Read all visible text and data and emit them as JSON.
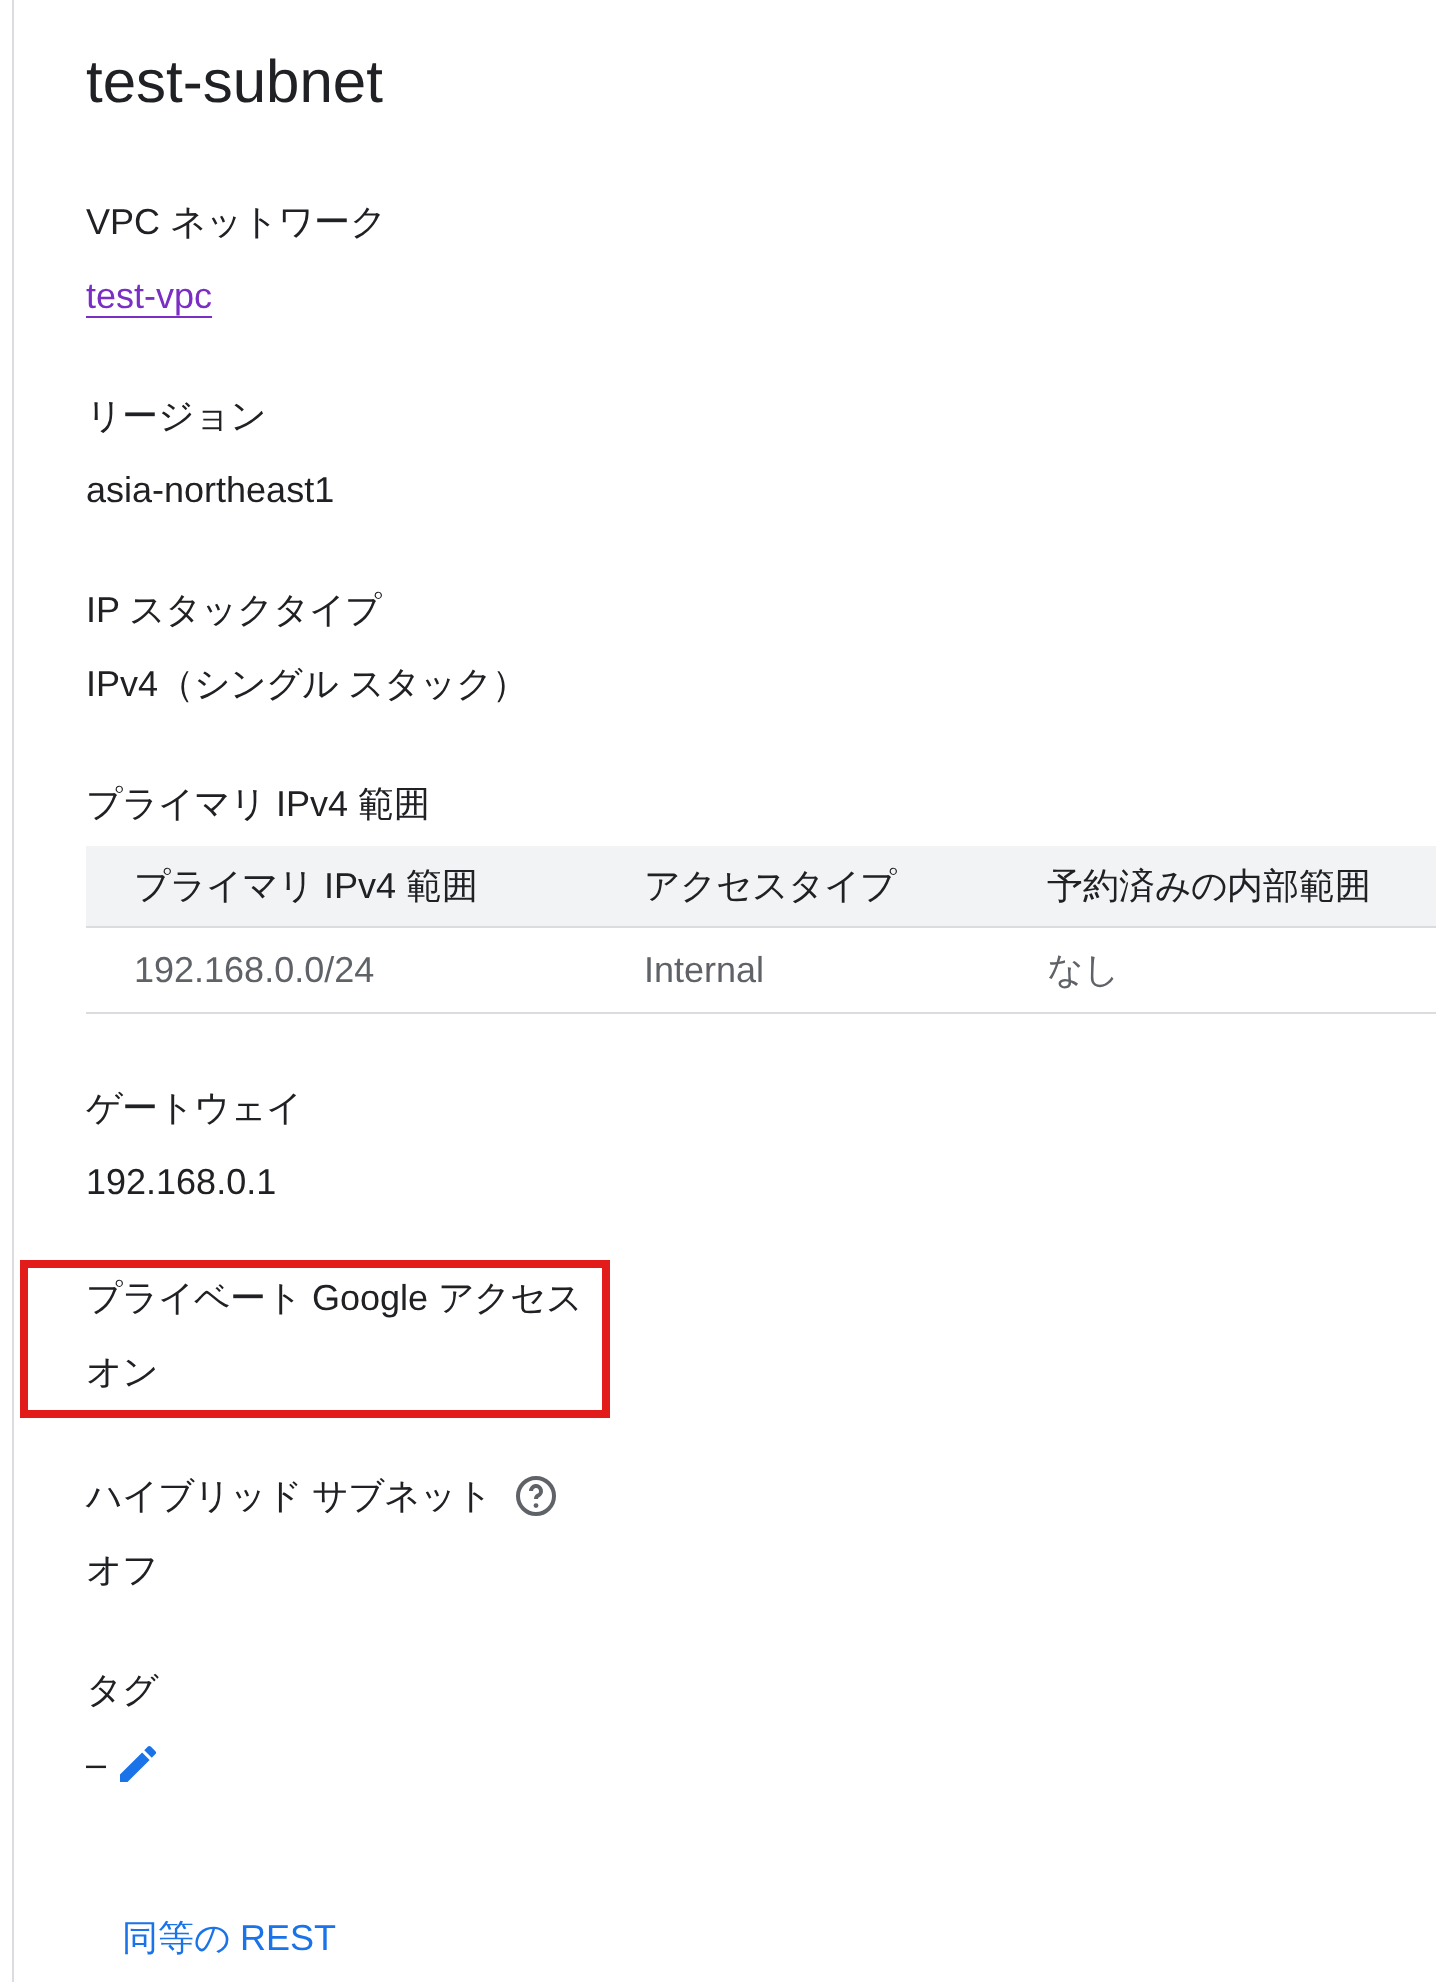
{
  "title": "test-subnet",
  "fields": [
    {
      "kind": "link",
      "label": "VPC ネットワーク",
      "value": "test-vpc",
      "help": false,
      "highlighted": false
    },
    {
      "kind": "text",
      "label": "リージョン",
      "value": "asia-northeast1",
      "help": false,
      "highlighted": false
    },
    {
      "kind": "text",
      "label": "IP スタックタイプ",
      "value": "IPv4（シングル スタック）",
      "help": false,
      "highlighted": false
    },
    {
      "kind": "table",
      "label": "プライマリ IPv4 範囲",
      "columns": [
        "プライマリ IPv4 範囲",
        "アクセスタイプ",
        "予約済みの内部範囲"
      ],
      "rows": [
        [
          "192.168.0.0/24",
          "Internal",
          "なし"
        ]
      ],
      "help": false,
      "highlighted": false
    },
    {
      "kind": "text",
      "label": "ゲートウェイ",
      "value": "192.168.0.1",
      "help": false,
      "highlighted": false
    },
    {
      "kind": "text",
      "label": "プライベート Google アクセス",
      "value": "オン",
      "help": false,
      "highlighted": true
    },
    {
      "kind": "text",
      "label": "ハイブリッド サブネット",
      "value": "オフ",
      "help": true,
      "highlighted": false
    },
    {
      "kind": "edit",
      "label": "タグ",
      "value": "–",
      "help": false,
      "highlighted": false
    }
  ],
  "footer_link": "同等の REST"
}
